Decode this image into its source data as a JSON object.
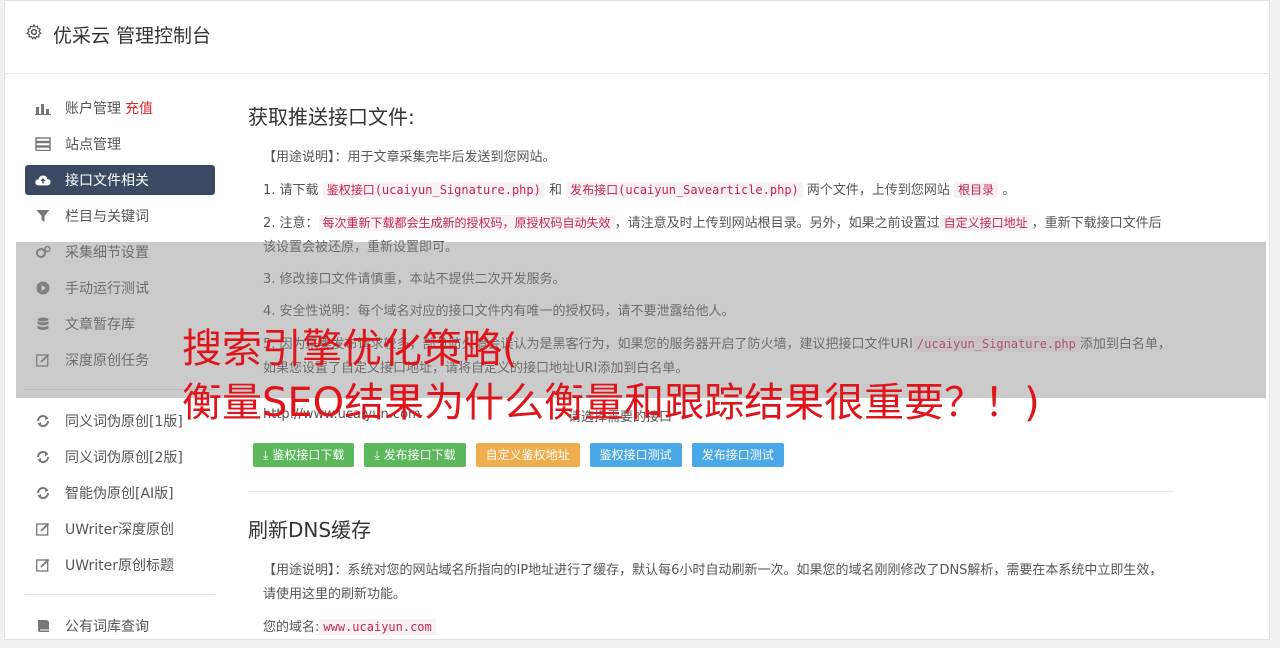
{
  "header": {
    "title": "优采云 管理控制台",
    "icon": "gear-icon"
  },
  "sidebar": {
    "items": [
      {
        "label": "账户管理",
        "badge": "充值",
        "icon": "bar-chart-icon",
        "active": false
      },
      {
        "label": "站点管理",
        "icon": "server-icon",
        "active": false
      },
      {
        "label": "接口文件相关",
        "icon": "cloud-upload-icon",
        "active": true
      },
      {
        "label": "栏目与关键词",
        "icon": "filter-icon",
        "active": false
      },
      {
        "label": "采集细节设置",
        "icon": "cogs-icon",
        "active": false
      },
      {
        "label": "手动运行测试",
        "icon": "play-circle-icon",
        "active": false
      },
      {
        "label": "文章暂存库",
        "icon": "database-icon",
        "active": false
      },
      {
        "label": "深度原创任务",
        "icon": "edit-icon",
        "active": false
      }
    ],
    "items2": [
      {
        "label": "同义词伪原创[1版]",
        "icon": "refresh-icon"
      },
      {
        "label": "同义词伪原创[2版]",
        "icon": "refresh-icon"
      },
      {
        "label": "智能伪原创[AI版]",
        "icon": "refresh-icon"
      },
      {
        "label": "UWriter深度原创",
        "icon": "edit-icon"
      },
      {
        "label": "UWriter原创标题",
        "icon": "edit-icon"
      }
    ],
    "items3": [
      {
        "label": "公有词库查询",
        "icon": "book-icon"
      }
    ]
  },
  "section1": {
    "title": "获取推送接口文件:",
    "usage": "【用途说明】：用于文章采集完毕后发送到您网站。",
    "p1": {
      "a": "1. 请下载",
      "code1": "鉴权接口(ucaiyun_Signature.php)",
      "b": "和",
      "code2": "发布接口(ucaiyun_Savearticle.php)",
      "c": "两个文件，上传到您网站",
      "code3": "根目录",
      "d": "。"
    },
    "p2": {
      "a": "2. 注意：",
      "code1": "每次重新下载都会生成新的授权码，原授权码自动失效",
      "b": "，请注意及时上传到网站根目录。另外，如果之前设置过",
      "code2": "自定义接口地址",
      "c": "，重新下载接口文件后该设置会被还原，重新设置即可。"
    },
    "p3": "3. 修改接口文件请慎重，本站不提供二次开发服务。",
    "p4": "4. 安全性说明：每个域名对应的接口文件内有唯一的授权码，请不要泄露给他人。",
    "p5": {
      "a": "5. 因为采集发布请求较多，部分防火墙会误认为是黑客行为，如果您的服务器开启了防火墙，建议把接口文件URI",
      "code1": "/ucaiyun_Signature.php",
      "b": "添加到白名单，如果您设置了自定义接口地址，请将自定义的接口地址URI添加到白名单。"
    },
    "url_value": "http://www.ucaiyun.com",
    "select_value": "请选择需要的接口",
    "buttons": [
      {
        "label": "鉴权接口下载",
        "color": "#5cb85c",
        "icon": "download-icon"
      },
      {
        "label": "发布接口下载",
        "color": "#5cb85c",
        "icon": "download-icon"
      },
      {
        "label": "自定义鉴权地址",
        "color": "#f0ad4e"
      },
      {
        "label": "鉴权接口测试",
        "color": "#4aa8e8"
      },
      {
        "label": "发布接口测试",
        "color": "#4aa8e8"
      }
    ]
  },
  "section2": {
    "title": "刷新DNS缓存",
    "usage": "【用途说明】：系统对您的网站域名所指向的IP地址进行了缓存，默认每6小时自动刷新一次。如果您的域名刚刚修改了DNS解析，需要在本系统中立即生效，请使用这里的刷新功能。",
    "domain_label": "您的域名:",
    "domain_value": "www.ucaiyun.com"
  },
  "overlay": {
    "line1": "搜索引擎优化策略(",
    "line2": "衡量SEO结果为什么衡量和跟踪结果很重要？！)",
    "color": "#e0151b"
  }
}
